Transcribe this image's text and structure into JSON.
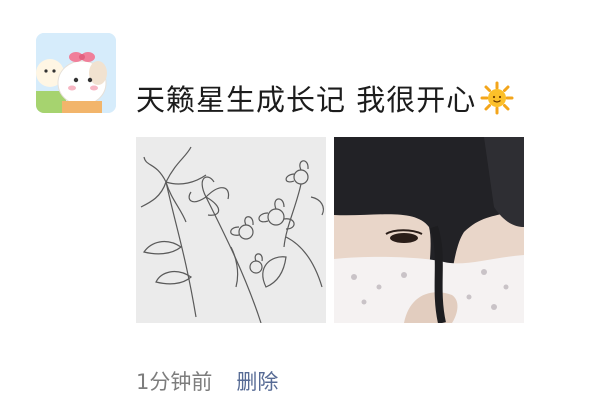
{
  "post": {
    "avatar_icon": "cartoon-characters-avatar",
    "text": "天籁星生成长记 我很开心",
    "emoji": "sun-emoji",
    "photos": [
      {
        "name": "floral-line-drawing-photo"
      },
      {
        "name": "selfie-with-mask-photo"
      }
    ],
    "time": "1分钟前",
    "delete_label": "删除"
  },
  "colors": {
    "link": "#576b95",
    "secondary_text": "#7d7d7d",
    "text": "#1c1c1c"
  }
}
